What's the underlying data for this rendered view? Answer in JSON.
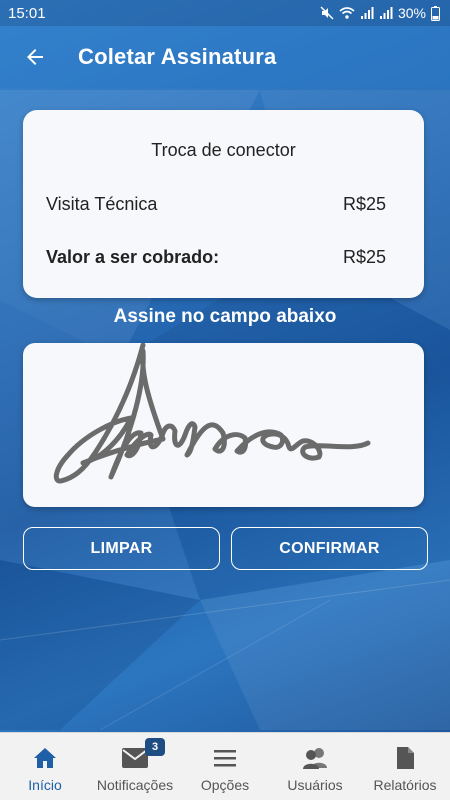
{
  "status_bar": {
    "time": "15:01",
    "battery": "30%"
  },
  "header": {
    "title": "Coletar Assinatura",
    "back_icon": "arrow-left-icon"
  },
  "summary": {
    "service": "Troca de conector",
    "items": [
      {
        "label": "Visita Técnica",
        "value": "R$25"
      },
      {
        "label": "Valor a ser cobrado:",
        "value": "R$25"
      }
    ]
  },
  "signature": {
    "instruction": "Assine no campo abaixo",
    "stroke_color": "#6b6b6b"
  },
  "actions": {
    "clear_label": "LIMPAR",
    "confirm_label": "CONFIRMAR"
  },
  "bottom_nav": {
    "items": [
      {
        "label": "Início",
        "icon": "home-icon",
        "active": true
      },
      {
        "label": "Notificações",
        "icon": "mail-icon",
        "badge": "3"
      },
      {
        "label": "Opções",
        "icon": "menu-icon"
      },
      {
        "label": "Usuários",
        "icon": "users-icon"
      },
      {
        "label": "Relatórios",
        "icon": "document-icon"
      }
    ]
  },
  "colors": {
    "primary": "#1e5fa8",
    "accent_dark": "#1e4d84",
    "card_bg": "#f6f8fb"
  }
}
